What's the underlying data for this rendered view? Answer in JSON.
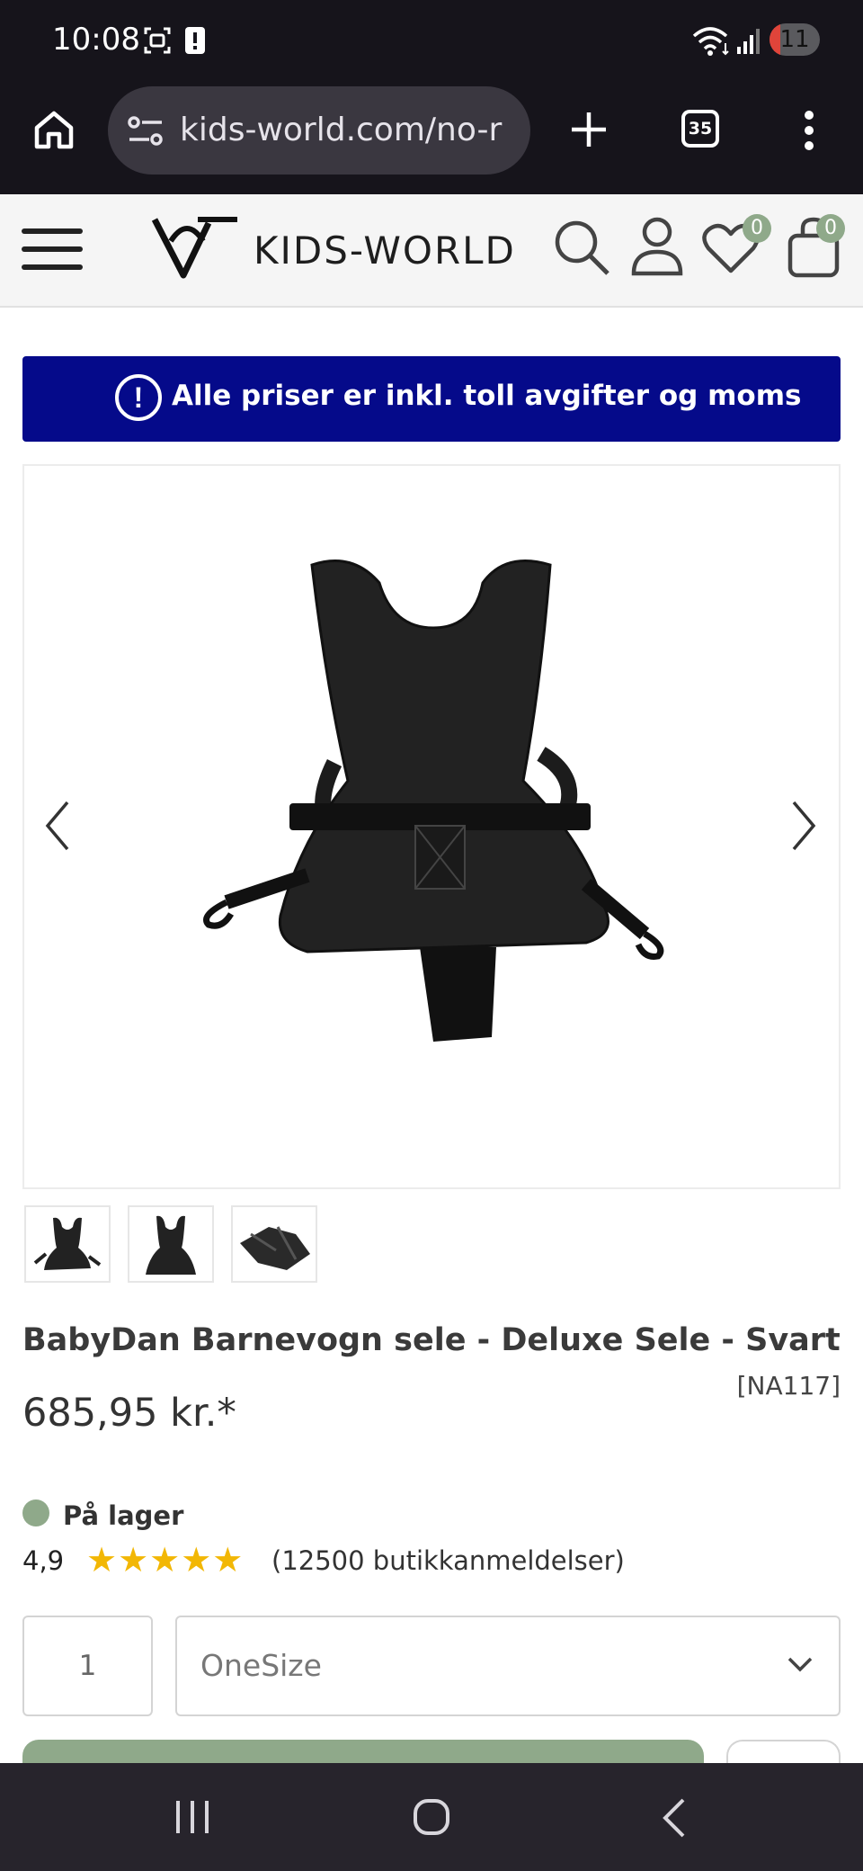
{
  "status_bar": {
    "time": "10:08",
    "battery_level": "11",
    "icons": [
      "screenshot-icon",
      "alert-icon",
      "wifi-icon",
      "signal-icon"
    ]
  },
  "browser": {
    "url": "kids-world.com/no-r",
    "tab_count": "35",
    "icons": [
      "home-icon",
      "site-settings-icon",
      "new-tab-icon",
      "tabs-icon",
      "more-icon"
    ]
  },
  "header": {
    "brand": "KIDS-WORLD",
    "wishlist_count": "0",
    "cart_count": "0",
    "icons": [
      "menu-icon",
      "search-icon",
      "account-icon",
      "heart-icon",
      "bag-icon"
    ]
  },
  "banner": {
    "text": "Alle priser er inkl. toll avgifter og moms",
    "color": "#050a8a"
  },
  "product": {
    "title": "BabyDan Barnevogn sele - Deluxe Sele - Svart",
    "sku": "[NA117]",
    "price": "685,95 kr.*",
    "stock": "På lager",
    "rating": "4,9",
    "stars": "★★★★★",
    "rating_score": 5,
    "review_count": "(12500 butikkanmeldelser)",
    "quantity": "1",
    "size": "OneSize"
  },
  "colors": {
    "accent": "#8fa98a",
    "star": "#f2b705",
    "dark": "#16141b"
  }
}
